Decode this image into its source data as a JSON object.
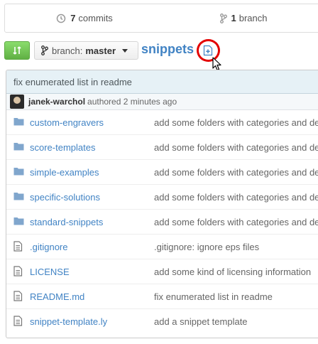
{
  "stats": {
    "commits_count": "7",
    "commits_label": "commits",
    "branch_count": "1",
    "branch_label": "branch"
  },
  "toolbar": {
    "branch_prefix": "branch:",
    "branch_name": "master",
    "repo_name": "snippets",
    "highlight_color": "#e30000"
  },
  "latest_commit": {
    "message": "fix enumerated list in readme",
    "author": "janek-warchol",
    "action": "authored 2 minutes ago"
  },
  "files": [
    {
      "name": "custom-engravers",
      "type": "folder",
      "message": "add some folders with categories and de"
    },
    {
      "name": "score-templates",
      "type": "folder",
      "message": "add some folders with categories and de"
    },
    {
      "name": "simple-examples",
      "type": "folder",
      "message": "add some folders with categories and de"
    },
    {
      "name": "specific-solutions",
      "type": "folder",
      "message": "add some folders with categories and de"
    },
    {
      "name": "standard-snippets",
      "type": "folder",
      "message": "add some folders with categories and de"
    },
    {
      "name": ".gitignore",
      "type": "file",
      "message": ".gitignore: ignore eps files"
    },
    {
      "name": "LICENSE",
      "type": "file",
      "message": "add some kind of licensing information"
    },
    {
      "name": "README.md",
      "type": "file",
      "message": "fix enumerated list in readme"
    },
    {
      "name": "snippet-template.ly",
      "type": "file",
      "message": "add a snippet template"
    }
  ],
  "colors": {
    "link": "#4183c4",
    "folder_icon": "#80a6cd",
    "file_icon": "#777777",
    "compare_green": "#60b044"
  }
}
